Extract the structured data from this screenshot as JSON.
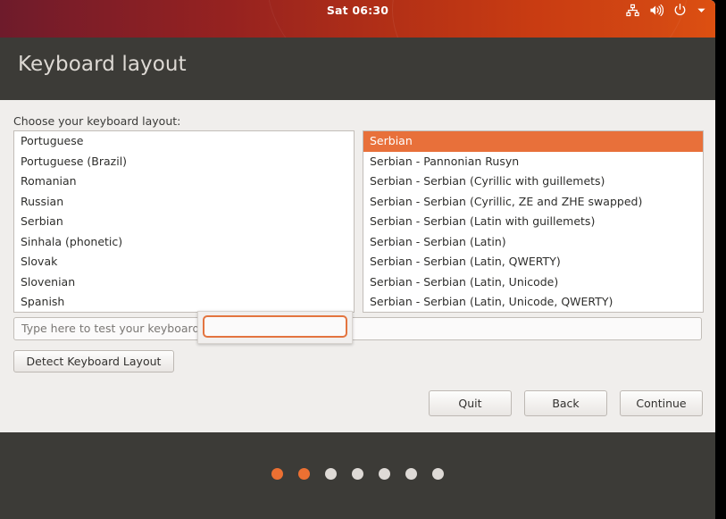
{
  "top_panel": {
    "clock": "Sat 06:30",
    "indicators": [
      {
        "name": "network-icon",
        "label": "network"
      },
      {
        "name": "volume-icon",
        "label": "volume"
      },
      {
        "name": "power-icon",
        "label": "power"
      },
      {
        "name": "chevron-down-icon",
        "label": "menu"
      }
    ],
    "gradient_left": "#6e1b2b",
    "gradient_right": "#dd5011"
  },
  "header": {
    "title": "Keyboard layout",
    "background": "#3c3b37",
    "text_color": "#ddd9d4"
  },
  "main": {
    "choose_label": "Choose your keyboard layout:",
    "language_list": [
      "Portuguese",
      "Portuguese (Brazil)",
      "Romanian",
      "Russian",
      "Serbian",
      "Sinhala (phonetic)",
      "Slovak",
      "Slovenian",
      "Spanish"
    ],
    "variant_list": [
      "Serbian",
      "Serbian - Pannonian Rusyn",
      "Serbian - Serbian (Cyrillic with guillemets)",
      "Serbian - Serbian (Cyrillic, ZE and ZHE swapped)",
      "Serbian - Serbian (Latin with guillemets)",
      "Serbian - Serbian (Latin)",
      "Serbian - Serbian (Latin, QWERTY)",
      "Serbian - Serbian (Latin, Unicode)",
      "Serbian - Serbian (Latin, Unicode, QWERTY)"
    ],
    "selected_variant_index": 0,
    "selection_color": "#e8703a",
    "test_entry_placeholder": "Type here to test your keyboard",
    "test_entry_value": "",
    "detect_button": "Detect Keyboard Layout"
  },
  "overlay": {
    "input_value": "",
    "border_color": "#e3743f"
  },
  "nav": {
    "quit": "Quit",
    "back": "Back",
    "continue": "Continue"
  },
  "footer": {
    "dot_count": 7,
    "active_dots": 2,
    "active_color": "#ec7032",
    "inactive_color": "#dedad6"
  }
}
